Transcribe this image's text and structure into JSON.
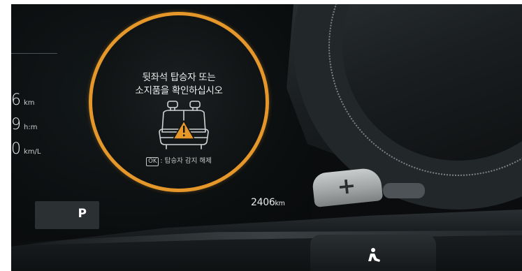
{
  "cluster": {
    "distance": {
      "value": "6",
      "unit": "km"
    },
    "time": {
      "value": "9",
      "unit": "h:m"
    },
    "economy": {
      "value": "0",
      "unit": "km/L"
    },
    "gear": "P",
    "odometer": {
      "value": "2406",
      "unit": "km"
    }
  },
  "warning": {
    "line1": "뒷좌석 탑승자 또는",
    "line2": "소지품을 확인하십시오",
    "ok_badge": "OK",
    "ok_hint": ": 탑승자 감지 해제",
    "icon": "rear-seat-warning-icon",
    "ring_color": "#e5972a"
  },
  "steering_wheel": {
    "paddle_label": "+",
    "paddle_icon": "plus-icon",
    "button_icon": "driving-assist-icon"
  }
}
